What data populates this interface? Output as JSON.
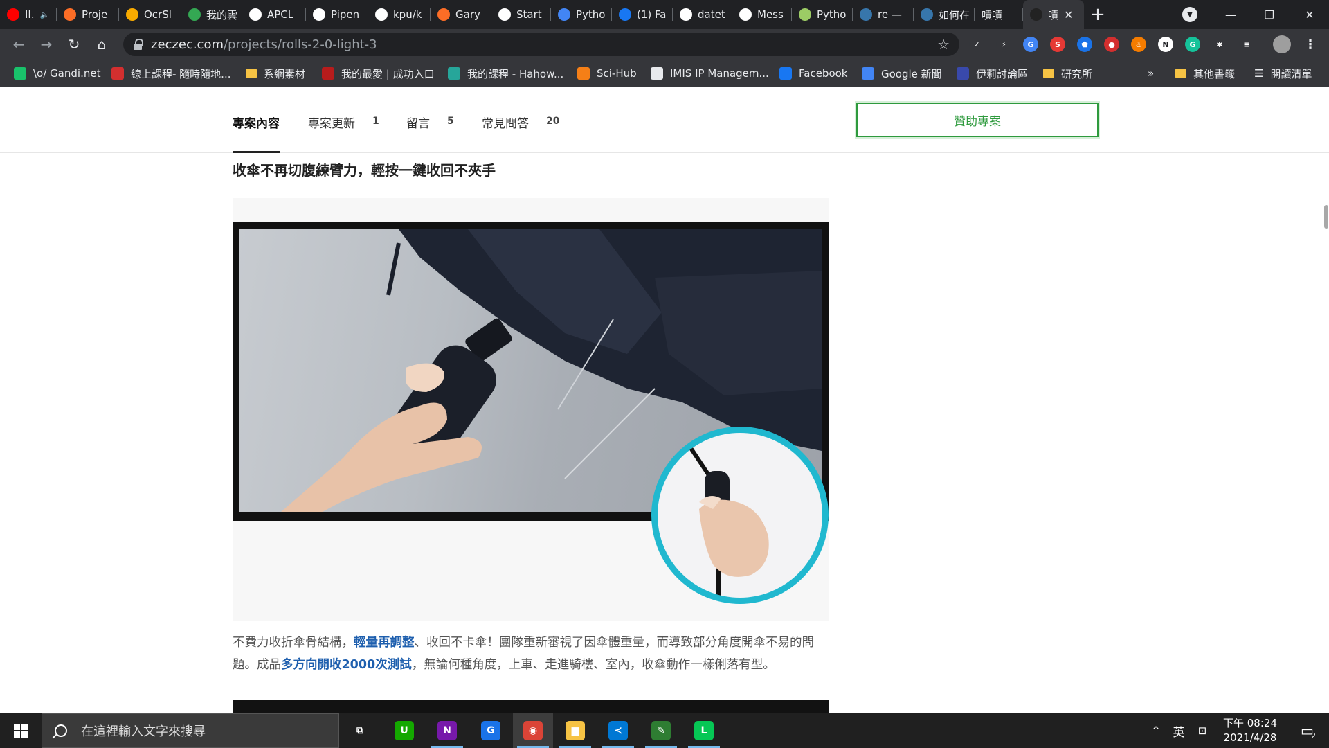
{
  "tabs": [
    {
      "title": "II.",
      "favicon": "youtube-icon",
      "color": "#ff0000",
      "audio": true
    },
    {
      "title": "Proje",
      "favicon": "gitlab-icon",
      "color": "#fc6d26"
    },
    {
      "title": "OcrSl",
      "favicon": "colab-icon",
      "color": "#f9ab00"
    },
    {
      "title": "我的雲",
      "favicon": "google-drive-icon",
      "color": "#34a853"
    },
    {
      "title": "APCL",
      "favicon": "github-icon",
      "color": "#ffffff"
    },
    {
      "title": "Pipen",
      "favicon": "medium-icon",
      "color": "#ffffff"
    },
    {
      "title": "kpu/k",
      "favicon": "github-icon",
      "color": "#ffffff"
    },
    {
      "title": "Gary",
      "favicon": "gitlab-icon",
      "color": "#fc6d26"
    },
    {
      "title": "Start",
      "favicon": "notion-icon",
      "color": "#ffffff"
    },
    {
      "title": "Pytho",
      "favicon": "g-docs-icon",
      "color": "#4285f4"
    },
    {
      "title": "(1) Fa",
      "favicon": "facebook-icon",
      "color": "#1877f2"
    },
    {
      "title": "datet",
      "favicon": "google-icon",
      "color": "#ffffff"
    },
    {
      "title": "Mess",
      "favicon": "google-icon",
      "color": "#ffffff"
    },
    {
      "title": "Pytho",
      "favicon": "chatbot-icon",
      "color": "#9ccc65"
    },
    {
      "title": "re —",
      "favicon": "python-icon",
      "color": "#3776ab"
    },
    {
      "title": "如何在",
      "favicon": "python-icon",
      "color": "#3776ab"
    },
    {
      "title": "嘖嘖",
      "favicon": "none",
      "color": "#202124"
    },
    {
      "title": "嘖",
      "favicon": "zeczec-icon",
      "color": "#222222",
      "active": true
    }
  ],
  "window_controls": {
    "minimize": "—",
    "restore": "❐",
    "close": "✕"
  },
  "toolbar": {
    "url_host": "zeczec.com",
    "url_path": "/projects/rolls-2-0-light-3"
  },
  "extensions": [
    {
      "name": "check-extension-icon",
      "color": "#35363a",
      "glyph": "✓"
    },
    {
      "name": "bolt-extension-icon",
      "color": "#35363a",
      "glyph": "⚡"
    },
    {
      "name": "translate-extension-icon",
      "color": "#4285f4",
      "glyph": "G"
    },
    {
      "name": "s-extension-icon",
      "color": "#e53935",
      "glyph": "S"
    },
    {
      "name": "shield-extension-icon",
      "color": "#1a73e8",
      "glyph": "⬟"
    },
    {
      "name": "record-extension-icon",
      "color": "#d32f2f",
      "glyph": "●"
    },
    {
      "name": "fire-extension-icon",
      "color": "#f57c00",
      "glyph": "♨"
    },
    {
      "name": "notion-extension-icon",
      "color": "#ffffff",
      "glyph": "N"
    },
    {
      "name": "grammarly-extension-icon",
      "color": "#15c39a",
      "glyph": "G"
    },
    {
      "name": "puzzle-extension-icon",
      "color": "#35363a",
      "glyph": "✱"
    },
    {
      "name": "media-extension-icon",
      "color": "#35363a",
      "glyph": "≡"
    }
  ],
  "bookmarks": [
    {
      "label": "\\o/ Gandi.net",
      "icon": "gandi-icon",
      "color": "#19c26b"
    },
    {
      "label": "線上課程- 隨時隨地...",
      "icon": "hahow-icon",
      "color": "#d32f2f"
    },
    {
      "label": "系網素材",
      "icon": "folder-icon",
      "color": "#f6c344"
    },
    {
      "label": "我的最愛 | 成功入口",
      "icon": "ncku-icon",
      "color": "#b71c1c"
    },
    {
      "label": "我的課程 - Hahow...",
      "icon": "hahow-course-icon",
      "color": "#26a69a"
    },
    {
      "label": "Sci-Hub",
      "icon": "scihub-icon",
      "color": "#f57f17"
    },
    {
      "label": "IMIS IP Managem...",
      "icon": "globe-icon",
      "color": "#e8eaed"
    },
    {
      "label": "Facebook",
      "icon": "facebook-icon",
      "color": "#1877f2"
    },
    {
      "label": "Google 新聞",
      "icon": "google-news-icon",
      "color": "#4285f4"
    },
    {
      "label": "伊莉討論區",
      "icon": "eyny-icon",
      "color": "#3949ab"
    },
    {
      "label": "研究所",
      "icon": "folder-icon",
      "color": "#f6c344"
    }
  ],
  "bookmarks_overflow": "»",
  "bookmarks_other": "其他書籤",
  "bookmarks_reading": "閱讀清單",
  "project_nav": {
    "items": [
      {
        "label": "專案內容",
        "count": ""
      },
      {
        "label": "專案更新",
        "count": "1"
      },
      {
        "label": "留言",
        "count": "5"
      },
      {
        "label": "常見問答",
        "count": "20"
      }
    ],
    "sponsor_label": "贊助專案"
  },
  "content": {
    "heading": "收傘不再切腹練臂力，輕按一鍵收回不夾手",
    "para_1": "不費力收折傘骨結構，",
    "para_hl_1": "輕量再調整",
    "para_2": "、收回不卡傘！團隊重新審視了因傘體重量，而導致部分角度開傘不易的問題。成品",
    "para_hl_2": "多方向開收2000次測試",
    "para_3": "，無論何種角度，上車、走進騎樓、室內，收傘動作一樣俐落有型。"
  },
  "colors": {
    "accent_green": "#2e9a3d",
    "highlight_blue": "#1e5fae",
    "inset_ring": "#20b8cf"
  },
  "taskbar": {
    "search_placeholder": "在這裡輸入文字來搜尋",
    "apps": [
      {
        "name": "task-view-icon",
        "glyph": "⧉",
        "color": "#202020",
        "running": false
      },
      {
        "name": "upwork-icon",
        "glyph": "U",
        "color": "#14a800",
        "running": false
      },
      {
        "name": "onenote-icon",
        "glyph": "N",
        "color": "#7719aa",
        "running": true
      },
      {
        "name": "grammarly-icon",
        "glyph": "G",
        "color": "#1a73e8",
        "running": false
      },
      {
        "name": "chrome-icon",
        "glyph": "◉",
        "color": "#db4437",
        "running": true,
        "focused": true
      },
      {
        "name": "file-explorer-icon",
        "glyph": "▆",
        "color": "#f6c344",
        "running": true
      },
      {
        "name": "vscode-icon",
        "glyph": "≺",
        "color": "#0078d4",
        "running": true
      },
      {
        "name": "pen-app-icon",
        "glyph": "✎",
        "color": "#2e7d32",
        "running": true
      },
      {
        "name": "line-icon",
        "glyph": "L",
        "color": "#06c755",
        "running": true
      }
    ],
    "tray_chevron": "^",
    "ime": "英",
    "clock_time": "下午 08:24",
    "clock_date": "2021/4/28",
    "notification_count": "2"
  }
}
